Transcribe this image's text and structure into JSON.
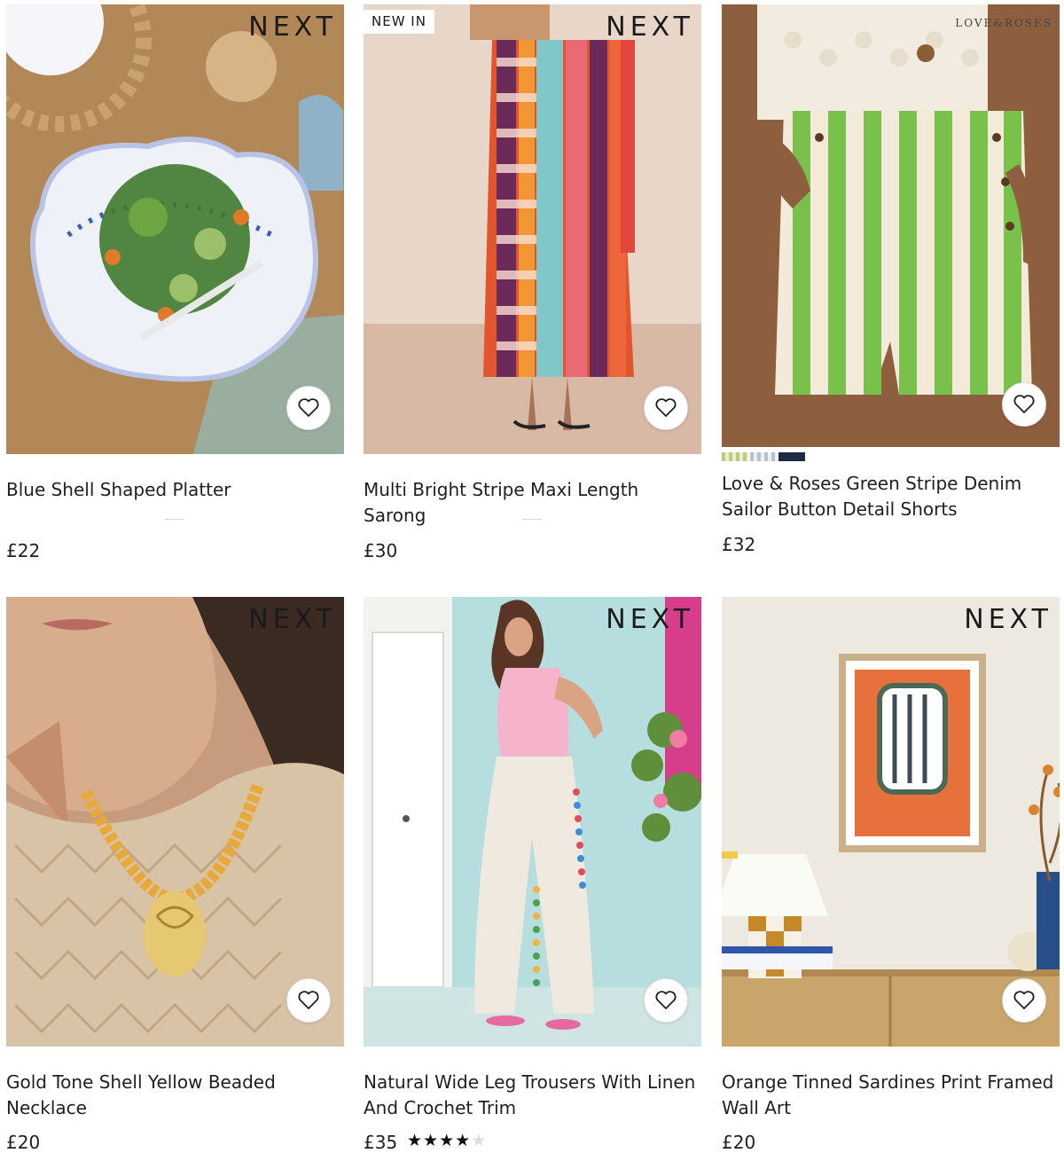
{
  "products": [
    {
      "title": "Blue Shell Shaped Platter",
      "price": "£22",
      "brand": "NEXT",
      "badge": ""
    },
    {
      "title": "Multi Bright Stripe Maxi Length Sarong",
      "price": "£30",
      "brand": "NEXT",
      "badge": "NEW IN"
    },
    {
      "title": "Love & Roses Green Stripe Denim Sailor Button Detail Shorts",
      "price": "£32",
      "brand": "LOVE&ROSES",
      "badge": ""
    },
    {
      "title": "Gold Tone Shell Yellow Beaded Necklace",
      "price": "£20",
      "brand": "NEXT",
      "badge": ""
    },
    {
      "title": "Natural Wide Leg Trousers With Linen And Crochet Trim",
      "price": "£35",
      "brand": "NEXT",
      "badge": "",
      "rating": 4
    },
    {
      "title": "Orange Tinned Sardines Print Framed Wall Art",
      "price": "£20",
      "brand": "NEXT",
      "badge": ""
    }
  ],
  "icons": {
    "favourite": "heart-outline-icon",
    "rating": "star-icon"
  },
  "colors": {
    "text": "#1f1f1f",
    "swatch_1": "#b5cf7a",
    "swatch_2": "#b8c2cf",
    "swatch_3": "#1c2a44"
  }
}
